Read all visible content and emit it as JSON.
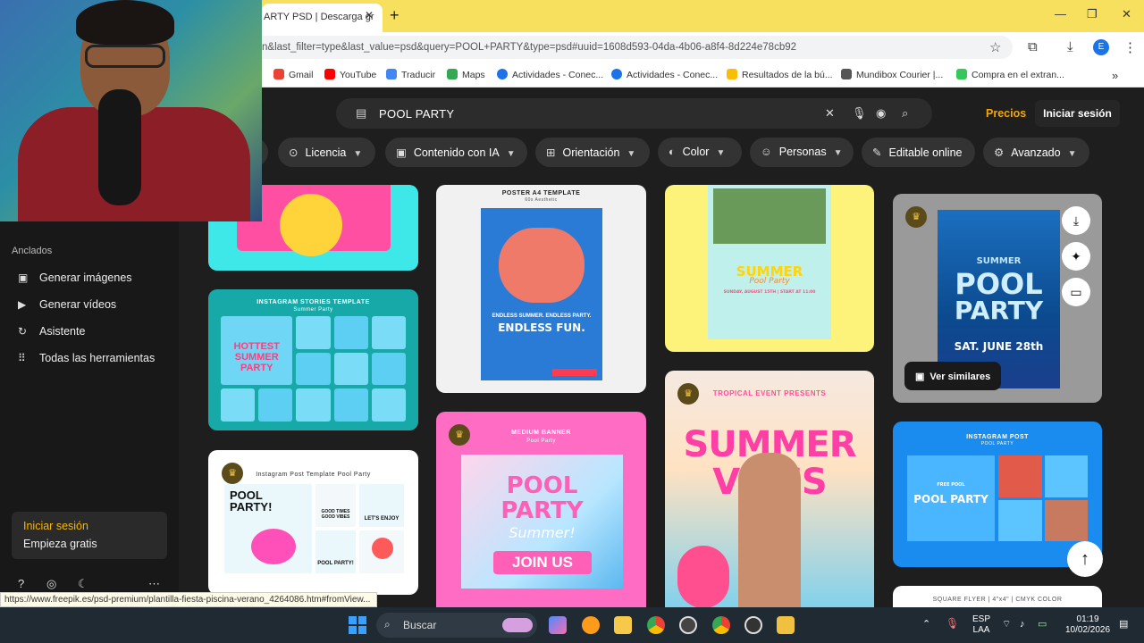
{
  "browser": {
    "tab_title": "ARTY PSD | Descarga gr",
    "url": "n&last_filter=type&last_value=psd&query=POOL+PARTY&type=psd#uuid=1608d593-04da-4b06-a8f4-8d224e78cb92",
    "profile_initial": "E",
    "bookmarks": [
      "Gmail",
      "YouTube",
      "Traducir",
      "Maps",
      "Actividades - Conec...",
      "Actividades - Conec...",
      "Resultados de la bú...",
      "Mundibox Courier |...",
      "Compra en el extran..."
    ],
    "bookmark_colors": [
      "#ea4335",
      "#ff0000",
      "#4285f4",
      "#34a853",
      "#1a73e8",
      "#1a73e8",
      "#fbbc04",
      "#555555",
      "#34c759"
    ]
  },
  "header": {
    "search_query": "POOL PARTY",
    "pricing_link": "Precios",
    "signin_button": "Iniciar sesión"
  },
  "filters": [
    {
      "label": "Licencia",
      "icon": "license-icon"
    },
    {
      "label": "Contenido con IA",
      "icon": "ai-icon"
    },
    {
      "label": "Orientación",
      "icon": "orientation-icon"
    },
    {
      "label": "Color",
      "icon": "palette-icon"
    },
    {
      "label": "Personas",
      "icon": "people-icon"
    },
    {
      "label": "Editable online",
      "icon": "pencil-icon"
    },
    {
      "label": "Avanzado",
      "icon": "settings-icon"
    }
  ],
  "sidebar": {
    "pinned_label": "Anclados",
    "items": [
      "Generar imágenes",
      "Generar vídeos",
      "Asistente",
      "Todas las herramientas"
    ],
    "login_title": "Iniciar sesión",
    "login_sub": "Empieza gratis"
  },
  "cards": {
    "c2_title": "INSTAGRAM STORIES TEMPLATE",
    "c2_sub": "Summer Party",
    "c2_tiles": [
      "HOTTEST SUMMER PARTY"
    ],
    "c3_title": "Instagram Post Template Pool Party",
    "c3_big": "POOL PARTY!",
    "c3_tile_a": "GOOD TIMES GOOD VIBES",
    "c3_tile_b": "LET'S ENJOY",
    "c3_tile_c": "POOL PARTY!",
    "c4_title": "POSTER A4 TEMPLATE",
    "c4_sub": "60s Aesthetic",
    "c4_big": "ENDLESS FUN.",
    "c4_strip": "ENDLESS SUMMER. ENDLESS PARTY.",
    "c5_title": "MEDIUM BANNER",
    "c5_sub": "Pool Party",
    "c5_big1": "POOL",
    "c5_big2": "PARTY",
    "c5_script": "Summer!",
    "c5_cta": "JOIN US",
    "c6_big": "SUMMER",
    "c6_sub": "Pool Party",
    "c6_line": "SUNDAY, AUGUST 15TH | START AT 11:00",
    "c7_title": "TROPICAL EVENT PRESENTS",
    "c7_big": "SUMMER VIBES",
    "c8_big1": "POOL",
    "c8_big2": "PARTY",
    "c8_top": "SUMMER",
    "c8_date": "SAT. JUNE 28th",
    "c8_similar": "Ver similares",
    "c9_title": "INSTAGRAM POST",
    "c9_sub": "POOL PARTY",
    "c9_big": "POOL PARTY",
    "c9_free": "FREE POOL",
    "c10_title": "SQUARE FLYER  |  4\"x4\"  |  CMYK COLOR"
  },
  "status_url": "https://www.freepik.es/psd-premium/plantilla-fiesta-piscina-verano_4264086.htm#fromView...",
  "taskbar": {
    "search_label": "Buscar",
    "lang1": "ESP",
    "lang2": "LAA",
    "time": "01:19",
    "date": "10/02/2026"
  }
}
